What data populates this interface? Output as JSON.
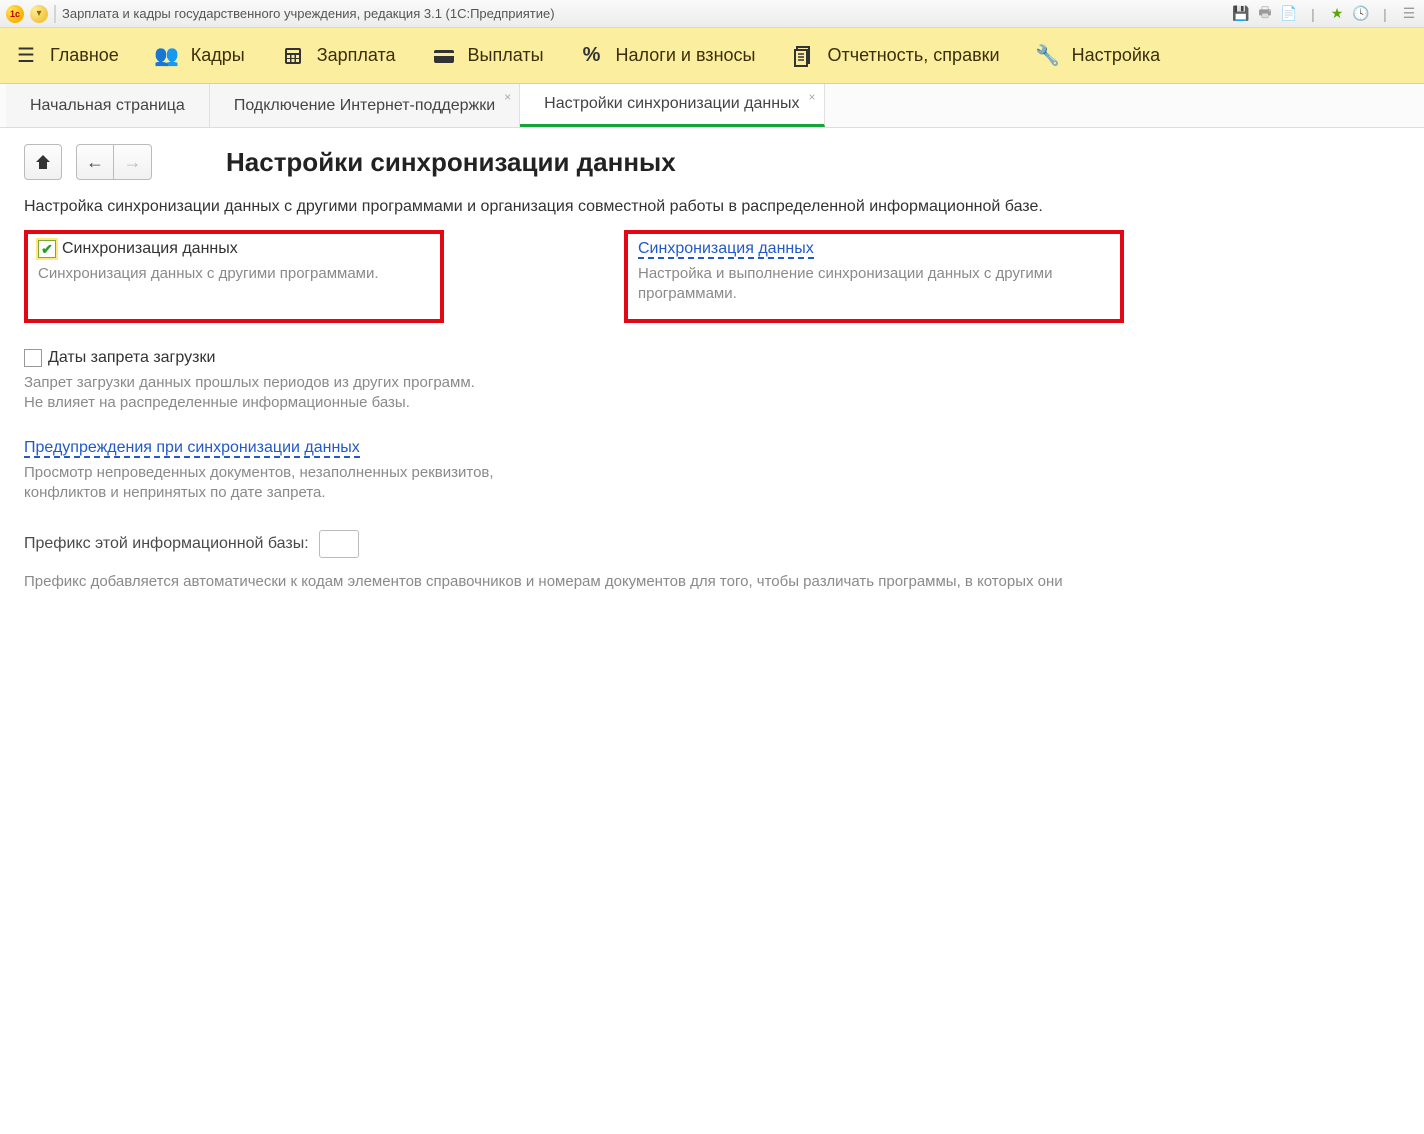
{
  "window": {
    "title": "Зарплата и кадры государственного учреждения, редакция 3.1  (1С:Предприятие)"
  },
  "mainmenu": {
    "items": [
      {
        "label": "Главное",
        "icon": "menu"
      },
      {
        "label": "Кадры",
        "icon": "people"
      },
      {
        "label": "Зарплата",
        "icon": "calc"
      },
      {
        "label": "Выплаты",
        "icon": "wallet"
      },
      {
        "label": "Налоги и взносы",
        "icon": "percent"
      },
      {
        "label": "Отчетность, справки",
        "icon": "docs"
      },
      {
        "label": "Настройка",
        "icon": "wrench"
      }
    ]
  },
  "tabs": {
    "items": [
      {
        "label": "Начальная страница",
        "closable": false,
        "active": false
      },
      {
        "label": "Подключение Интернет-поддержки",
        "closable": true,
        "active": false
      },
      {
        "label": "Настройки синхронизации данных",
        "closable": true,
        "active": true
      }
    ]
  },
  "page": {
    "title": "Настройки синхронизации данных",
    "intro": "Настройка синхронизации данных с другими программами и организация совместной работы в распределенной информационной базе."
  },
  "sync_checkbox": {
    "label": "Синхронизация данных",
    "desc": "Синхронизация данных с другими программами."
  },
  "sync_link": {
    "label": "Синхронизация данных",
    "desc": "Настройка и выполнение синхронизации данных с другими программами."
  },
  "load_dates": {
    "label": "Даты запрета загрузки",
    "desc": "Запрет загрузки данных прошлых периодов из других программ.\nНе влияет на распределенные информационные базы."
  },
  "warnings": {
    "label": "Предупреждения при синхронизации данных",
    "desc": "Просмотр непроведенных документов, незаполненных реквизитов,\nконфликтов и непринятых по дате запрета."
  },
  "prefix": {
    "label": "Префикс этой информационной базы:",
    "desc": "Префикс добавляется автоматически к кодам элементов справочников и номерам документов для того, чтобы различать программы, в которых они"
  }
}
